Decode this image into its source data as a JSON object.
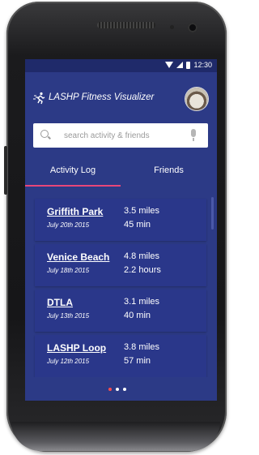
{
  "status_bar": {
    "time": "12:30"
  },
  "app": {
    "title": "LASHP Fitness Visualizer",
    "logo_icon": "runner-icon",
    "avatar_icon": "avatar-icon"
  },
  "search": {
    "placeholder": "search activity & friends"
  },
  "tabs": [
    {
      "label": "Activity Log",
      "active": true
    },
    {
      "label": "Friends",
      "active": false
    }
  ],
  "activities": [
    {
      "location": "Griffith Park",
      "date": "July 20th 2015",
      "distance": "3.5 miles",
      "duration": "45 min"
    },
    {
      "location": "Venice Beach",
      "date": "July 18th 2015",
      "distance": "4.8 miles",
      "duration": "2.2 hours"
    },
    {
      "location": "DTLA",
      "date": "July 13th 2015",
      "distance": "3.1 miles",
      "duration": "40 min"
    },
    {
      "location": "LASHP Loop",
      "date": "July 12th 2015",
      "distance": "3.8 miles",
      "duration": "57 min"
    }
  ],
  "page_indicator": {
    "count": 3,
    "active": 0
  },
  "colors": {
    "primary": "#2c3a86",
    "accent": "#e8467a",
    "indicator": "#ff4d4d"
  }
}
